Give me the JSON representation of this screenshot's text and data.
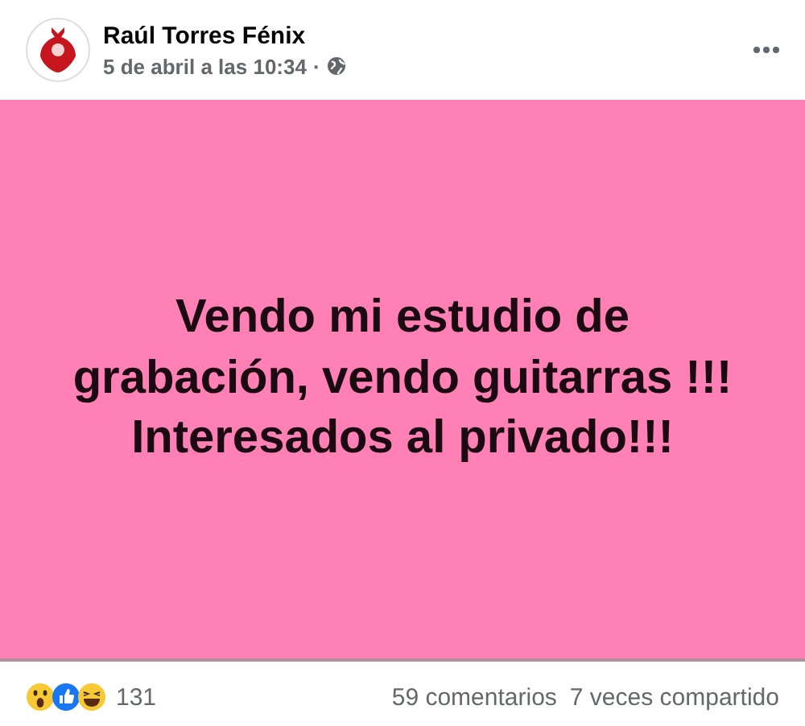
{
  "post": {
    "author": "Raúl Torres Fénix",
    "timestamp": "5 de abril a las 10:34",
    "separator": "·",
    "text": "Vendo mi estudio de grabación, vendo guitarras !!! Interesados al privado!!!"
  },
  "reactions": {
    "types": [
      {
        "kind": "wow"
      },
      {
        "kind": "like"
      },
      {
        "kind": "haha"
      }
    ],
    "count": "131"
  },
  "stats": {
    "comments": "59 comentarios",
    "shares": "7 veces compartido"
  }
}
